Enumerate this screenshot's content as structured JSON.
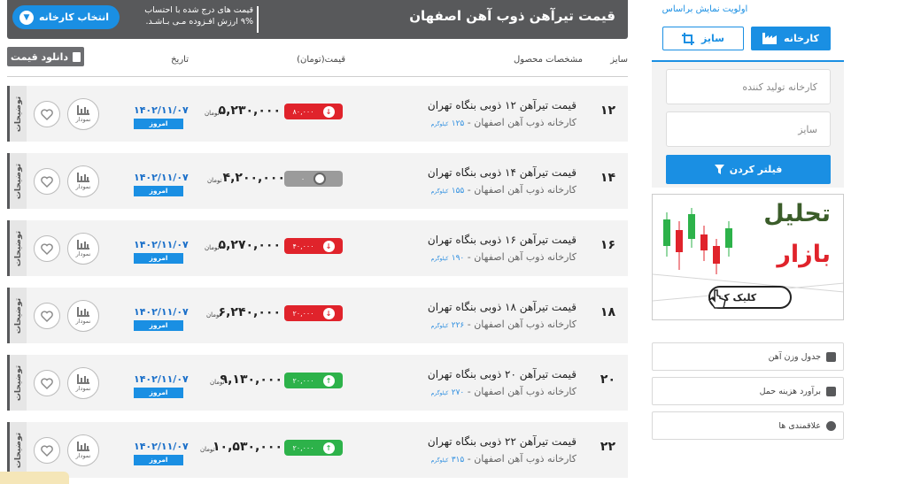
{
  "header": {
    "title": "قیمت تیرآهن ذوب آهن اصفهان",
    "note_line1": "قیمت های درج شده با احتساب",
    "note_line2": "۹% ارزش افـزوده مـی بـاشـد.",
    "factory_button": "انتخاب کارخانه"
  },
  "columns": {
    "size": "سایز",
    "specs": "مشخصات محصول",
    "price": "قیمت(تومان)",
    "date": "تاریخ"
  },
  "download_button": "دانلود قیمت",
  "rows": [
    {
      "size": "۱۲",
      "name": "قیمت تیرآهن ۱۲ ذوبی بنگاه تهران",
      "maker": "کارخانه ذوب آهن اصفهان - ",
      "weight": "۱۲۵",
      "kg": "کیلوگرم",
      "change": "۸۰,۰۰۰",
      "change_dir": "down",
      "price": "۵,۲۳۰,۰۰۰",
      "unit": "تومان",
      "date": "۱۴۰۲/۱۱/۰۷",
      "today": "امروز",
      "chart": "نمودار",
      "side": "توضیحات"
    },
    {
      "size": "۱۴",
      "name": "قیمت تیرآهن ۱۴ ذوبی بنگاه تهران",
      "maker": "کارخانه ذوب آهن اصفهان - ",
      "weight": "۱۵۵",
      "kg": "کیلوگرم",
      "change": "۰",
      "change_dir": "none",
      "price": "۴,۲۰۰,۰۰۰",
      "unit": "تومان",
      "date": "۱۴۰۲/۱۱/۰۷",
      "today": "امروز",
      "chart": "نمودار",
      "side": "توضیحات"
    },
    {
      "size": "۱۶",
      "name": "قیمت تیرآهن ۱۶ ذوبی بنگاه تهران",
      "maker": "کارخانه ذوب آهن اصفهان - ",
      "weight": "۱۹۰",
      "kg": "کیلوگرم",
      "change": "۴۰,۰۰۰",
      "change_dir": "down",
      "price": "۵,۲۷۰,۰۰۰",
      "unit": "تومان",
      "date": "۱۴۰۲/۱۱/۰۷",
      "today": "امروز",
      "chart": "نمودار",
      "side": "توضیحات"
    },
    {
      "size": "۱۸",
      "name": "قیمت تیرآهن ۱۸ ذوبی بنگاه تهران",
      "maker": "کارخانه ذوب آهن اصفهان - ",
      "weight": "۲۲۶",
      "kg": "کیلوگرم",
      "change": "۲۰,۰۰۰",
      "change_dir": "down",
      "price": "۶,۲۴۰,۰۰۰",
      "unit": "تومان",
      "date": "۱۴۰۲/۱۱/۰۷",
      "today": "امروز",
      "chart": "نمودار",
      "side": "توضیحات"
    },
    {
      "size": "۲۰",
      "name": "قیمت تیرآهن ۲۰ ذوبی بنگاه تهران",
      "maker": "کارخانه ذوب آهن اصفهان - ",
      "weight": "۲۷۰",
      "kg": "کیلوگرم",
      "change": "۲۰,۰۰۰",
      "change_dir": "up",
      "price": "۹,۱۳۰,۰۰۰",
      "unit": "تومان",
      "date": "۱۴۰۲/۱۱/۰۷",
      "today": "امروز",
      "chart": "نمودار",
      "side": "توضیحات"
    },
    {
      "size": "۲۲",
      "name": "قیمت تیرآهن ۲۲ ذوبی بنگاه تهران",
      "maker": "کارخانه ذوب آهن اصفهان - ",
      "weight": "۳۱۵",
      "kg": "کیلوگرم",
      "change": "۲۰,۰۰۰",
      "change_dir": "up",
      "price": "۱۰,۵۳۰,۰۰۰",
      "unit": "تومان",
      "date": "۱۴۰۲/۱۱/۰۷",
      "today": "امروز",
      "chart": "نمودار",
      "side": "توضیحات"
    }
  ],
  "sidebar": {
    "priority_title": "اولویت نمایش براساس",
    "tab_factory": "کارخانه",
    "tab_size": "سایز",
    "maker_placeholder": "کارخانه تولید کننده",
    "size_placeholder": "سایز",
    "filter_button": "فیلتر کردن",
    "ad_line1": "تحلیل",
    "ad_line2": "بازار",
    "ad_cta": "کلیک کنید",
    "links": [
      "جدول وزن آهن",
      "برآورد هزینه حمل",
      "علاقمندی ها"
    ]
  },
  "colors": {
    "accent": "#1a8fe3",
    "header_bg": "#58595b",
    "down": "#e0232b",
    "up": "#2db24a",
    "neutral": "#9b9b9b"
  }
}
